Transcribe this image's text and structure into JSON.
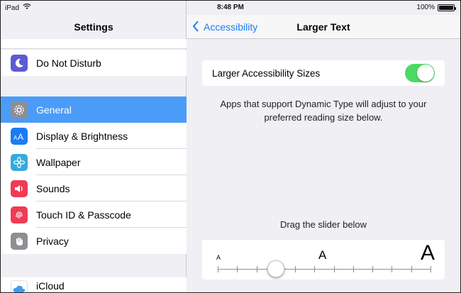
{
  "status_bar": {
    "device": "iPad",
    "time": "8:48 PM",
    "battery_text": "100%",
    "battery_level": 1.0
  },
  "sidebar": {
    "title": "Settings",
    "items": [
      {
        "label": "Do Not Disturb",
        "icon": "moon-icon",
        "color": "#5d5bd3"
      },
      {
        "label": "General",
        "icon": "gear-icon",
        "color": "#8e8e93",
        "selected": true
      },
      {
        "label": "Display & Brightness",
        "icon": "text-size-icon",
        "color": "#1a7cf5"
      },
      {
        "label": "Wallpaper",
        "icon": "flower-icon",
        "color": "#35aadc"
      },
      {
        "label": "Sounds",
        "icon": "speaker-icon",
        "color": "#ef3b55"
      },
      {
        "label": "Touch ID & Passcode",
        "icon": "fingerprint-icon",
        "color": "#ef3b55"
      },
      {
        "label": "Privacy",
        "icon": "hand-icon",
        "color": "#8e8e93"
      },
      {
        "label": "iCloud",
        "icon": "cloud-icon",
        "color": "#ffffff"
      }
    ]
  },
  "nav": {
    "back_label": "Accessibility",
    "title": "Larger Text"
  },
  "larger_sizes": {
    "label": "Larger Accessibility Sizes",
    "on": true,
    "on_color": "#4cd964"
  },
  "description": "Apps that support Dynamic Type will adjust to your preferred reading size below.",
  "slider": {
    "caption": "Drag the slider below",
    "small_glyph": "A",
    "mid_glyph": "A",
    "large_glyph": "A",
    "ticks": 12,
    "selected_step": 3
  },
  "accent_color": "#1a7cf5",
  "selection_color": "#4a9cf8"
}
